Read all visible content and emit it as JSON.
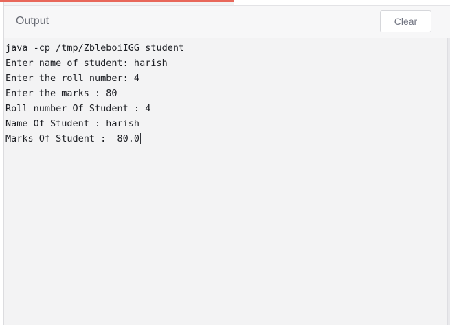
{
  "output_panel": {
    "title": "Output",
    "clear_label": "Clear"
  },
  "console": {
    "lines": [
      "java -cp /tmp/ZbleboiIGG student",
      "Enter name of student: harish",
      "Enter the roll number: 4",
      "Enter the marks : 80",
      "Roll number Of Student : 4",
      "Name Of Student : harish",
      "Marks Of Student :  80.0"
    ]
  },
  "colors": {
    "accent": "#e8675a",
    "background": "#f3f3f4",
    "text": "#1d1f24"
  }
}
